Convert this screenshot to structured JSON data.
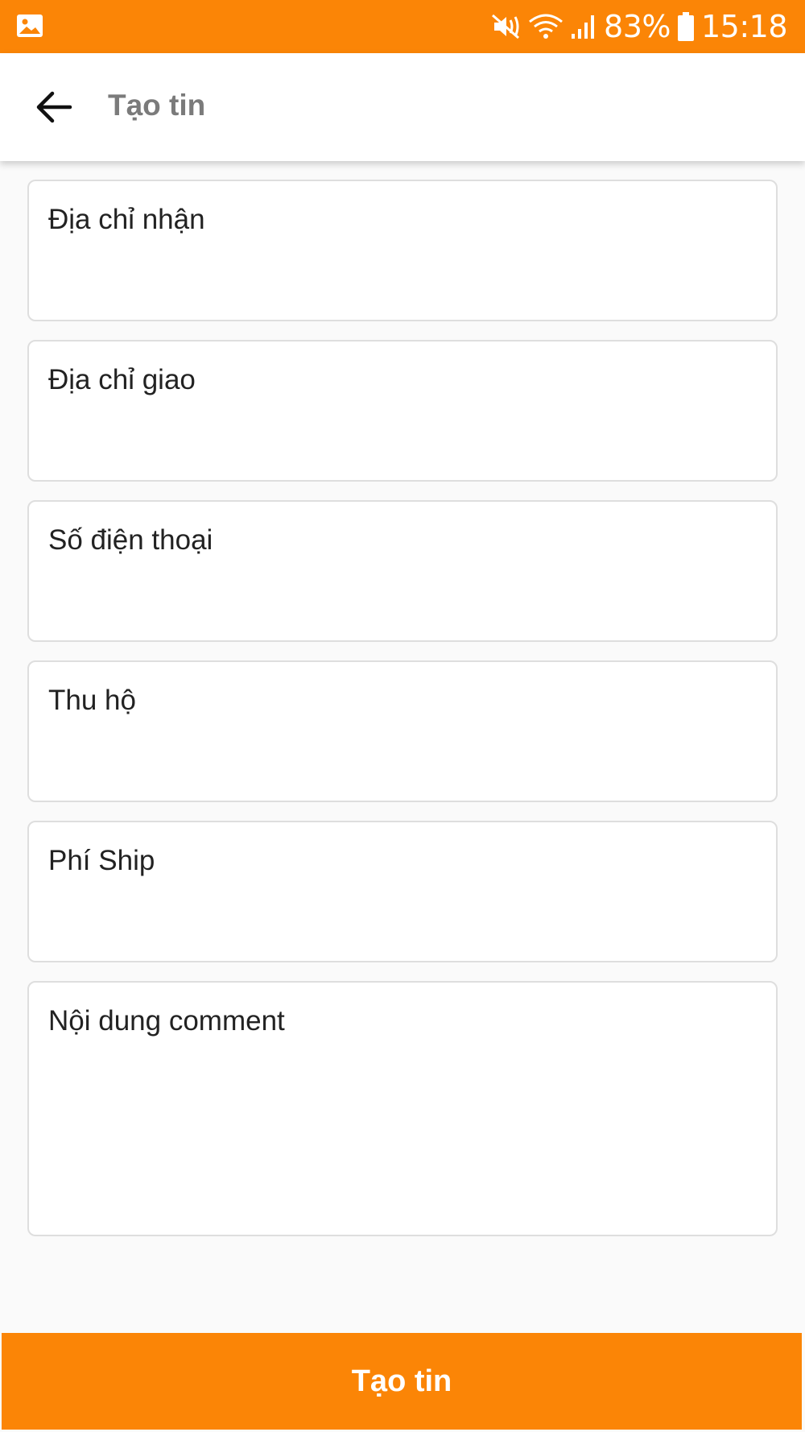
{
  "status_bar": {
    "battery": "83%",
    "time": "15:18",
    "icons": [
      "gallery-icon",
      "mute-icon",
      "wifi-icon",
      "signal-icon",
      "battery-icon"
    ]
  },
  "app_bar": {
    "title": "Tạo tin",
    "back_icon": "arrow-left-icon"
  },
  "form": {
    "fields": [
      {
        "placeholder": "Địa chỉ nhận",
        "value": ""
      },
      {
        "placeholder": "Địa chỉ giao",
        "value": ""
      },
      {
        "placeholder": "Số điện thoại",
        "value": ""
      },
      {
        "placeholder": "Thu hộ",
        "value": ""
      },
      {
        "placeholder": "Phí Ship",
        "value": ""
      },
      {
        "placeholder": "Nội dung comment",
        "value": ""
      }
    ]
  },
  "submit": {
    "label": "Tạo tin"
  },
  "colors": {
    "accent": "#fb8506",
    "title_gray": "#7b7b7b"
  }
}
